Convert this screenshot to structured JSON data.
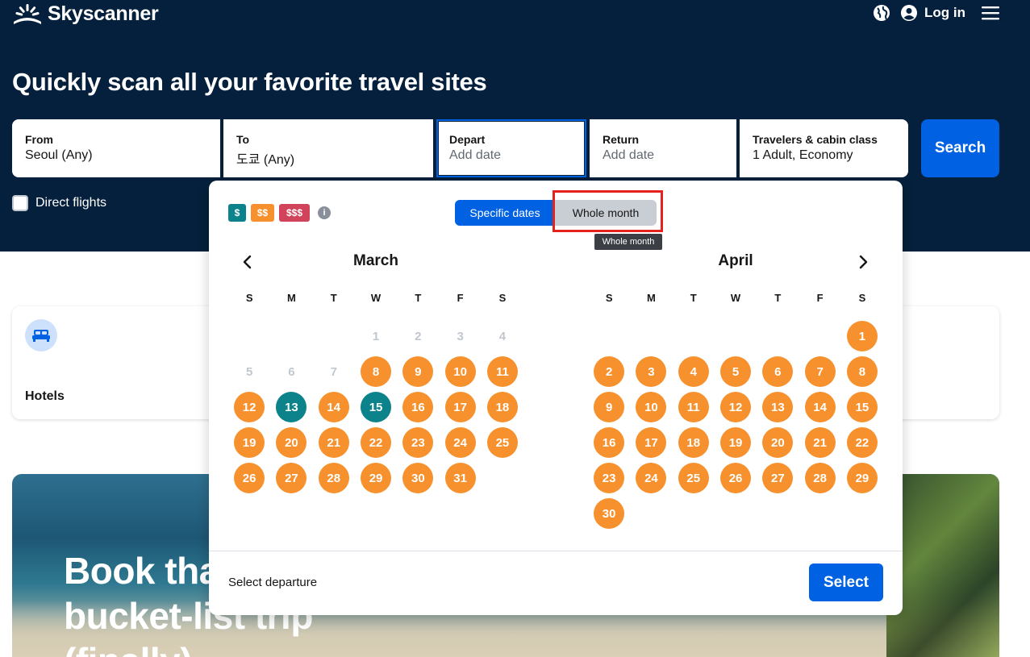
{
  "brand": {
    "name": "Skyscanner"
  },
  "nav": {
    "login_label": "Log in",
    "globe_icon": "globe-icon",
    "account_icon": "account-icon",
    "menu_icon": "hamburger-menu-icon"
  },
  "hero": {
    "headline": "Quickly scan all your favorite travel sites"
  },
  "search": {
    "from": {
      "label": "From",
      "value": "Seoul (Any)"
    },
    "to": {
      "label": "To",
      "value": "도쿄 (Any)"
    },
    "depart": {
      "label": "Depart",
      "placeholder": "Add date"
    },
    "return": {
      "label": "Return",
      "placeholder": "Add date"
    },
    "travelers": {
      "label": "Travelers & cabin class",
      "value": "1 Adult, Economy"
    },
    "button_label": "Search",
    "direct_flights_label": "Direct flights"
  },
  "hotels": {
    "label": "Hotels"
  },
  "promo": {
    "line1": "Book that",
    "line2": "bucket-list trip",
    "line3": "(finally)"
  },
  "calendar": {
    "legend": [
      "$",
      "$$",
      "$$$"
    ],
    "info_icon": "info-icon",
    "tabs": {
      "specific": "Specific dates",
      "whole_month": "Whole month"
    },
    "tooltip": "Whole month",
    "weekdays": [
      "S",
      "M",
      "T",
      "W",
      "T",
      "F",
      "S"
    ],
    "months": [
      {
        "name": "March",
        "leading_blanks": 3,
        "days": [
          {
            "d": "1",
            "s": "past"
          },
          {
            "d": "2",
            "s": "past"
          },
          {
            "d": "3",
            "s": "past"
          },
          {
            "d": "4",
            "s": "past"
          },
          {
            "d": "5",
            "s": "past"
          },
          {
            "d": "6",
            "s": "past"
          },
          {
            "d": "7",
            "s": "past"
          },
          {
            "d": "8",
            "s": "orange"
          },
          {
            "d": "9",
            "s": "orange"
          },
          {
            "d": "10",
            "s": "orange"
          },
          {
            "d": "11",
            "s": "orange"
          },
          {
            "d": "12",
            "s": "orange"
          },
          {
            "d": "13",
            "s": "teal"
          },
          {
            "d": "14",
            "s": "orange"
          },
          {
            "d": "15",
            "s": "teal"
          },
          {
            "d": "16",
            "s": "orange"
          },
          {
            "d": "17",
            "s": "orange"
          },
          {
            "d": "18",
            "s": "orange"
          },
          {
            "d": "19",
            "s": "orange"
          },
          {
            "d": "20",
            "s": "orange"
          },
          {
            "d": "21",
            "s": "orange"
          },
          {
            "d": "22",
            "s": "orange"
          },
          {
            "d": "23",
            "s": "orange"
          },
          {
            "d": "24",
            "s": "orange"
          },
          {
            "d": "25",
            "s": "orange"
          },
          {
            "d": "26",
            "s": "orange"
          },
          {
            "d": "27",
            "s": "orange"
          },
          {
            "d": "28",
            "s": "orange"
          },
          {
            "d": "29",
            "s": "orange"
          },
          {
            "d": "30",
            "s": "orange"
          },
          {
            "d": "31",
            "s": "orange"
          }
        ]
      },
      {
        "name": "April",
        "leading_blanks": 6,
        "days": [
          {
            "d": "1",
            "s": "orange"
          },
          {
            "d": "2",
            "s": "orange"
          },
          {
            "d": "3",
            "s": "orange"
          },
          {
            "d": "4",
            "s": "orange"
          },
          {
            "d": "5",
            "s": "orange"
          },
          {
            "d": "6",
            "s": "orange"
          },
          {
            "d": "7",
            "s": "orange"
          },
          {
            "d": "8",
            "s": "orange"
          },
          {
            "d": "9",
            "s": "orange"
          },
          {
            "d": "10",
            "s": "orange"
          },
          {
            "d": "11",
            "s": "orange"
          },
          {
            "d": "12",
            "s": "orange"
          },
          {
            "d": "13",
            "s": "orange"
          },
          {
            "d": "14",
            "s": "orange"
          },
          {
            "d": "15",
            "s": "orange"
          },
          {
            "d": "16",
            "s": "orange"
          },
          {
            "d": "17",
            "s": "orange"
          },
          {
            "d": "18",
            "s": "orange"
          },
          {
            "d": "19",
            "s": "orange"
          },
          {
            "d": "20",
            "s": "orange"
          },
          {
            "d": "21",
            "s": "orange"
          },
          {
            "d": "22",
            "s": "orange"
          },
          {
            "d": "23",
            "s": "orange"
          },
          {
            "d": "24",
            "s": "orange"
          },
          {
            "d": "25",
            "s": "orange"
          },
          {
            "d": "26",
            "s": "orange"
          },
          {
            "d": "27",
            "s": "orange"
          },
          {
            "d": "28",
            "s": "orange"
          },
          {
            "d": "29",
            "s": "orange"
          },
          {
            "d": "30",
            "s": "orange"
          }
        ]
      }
    ],
    "footer_text": "Select departure",
    "select_label": "Select"
  },
  "colors": {
    "navy": "#05203c",
    "blue": "#0062e3",
    "orange": "#f7912d",
    "teal": "#0c838a",
    "red": "#d1435b",
    "highlight": "#e5221e"
  }
}
